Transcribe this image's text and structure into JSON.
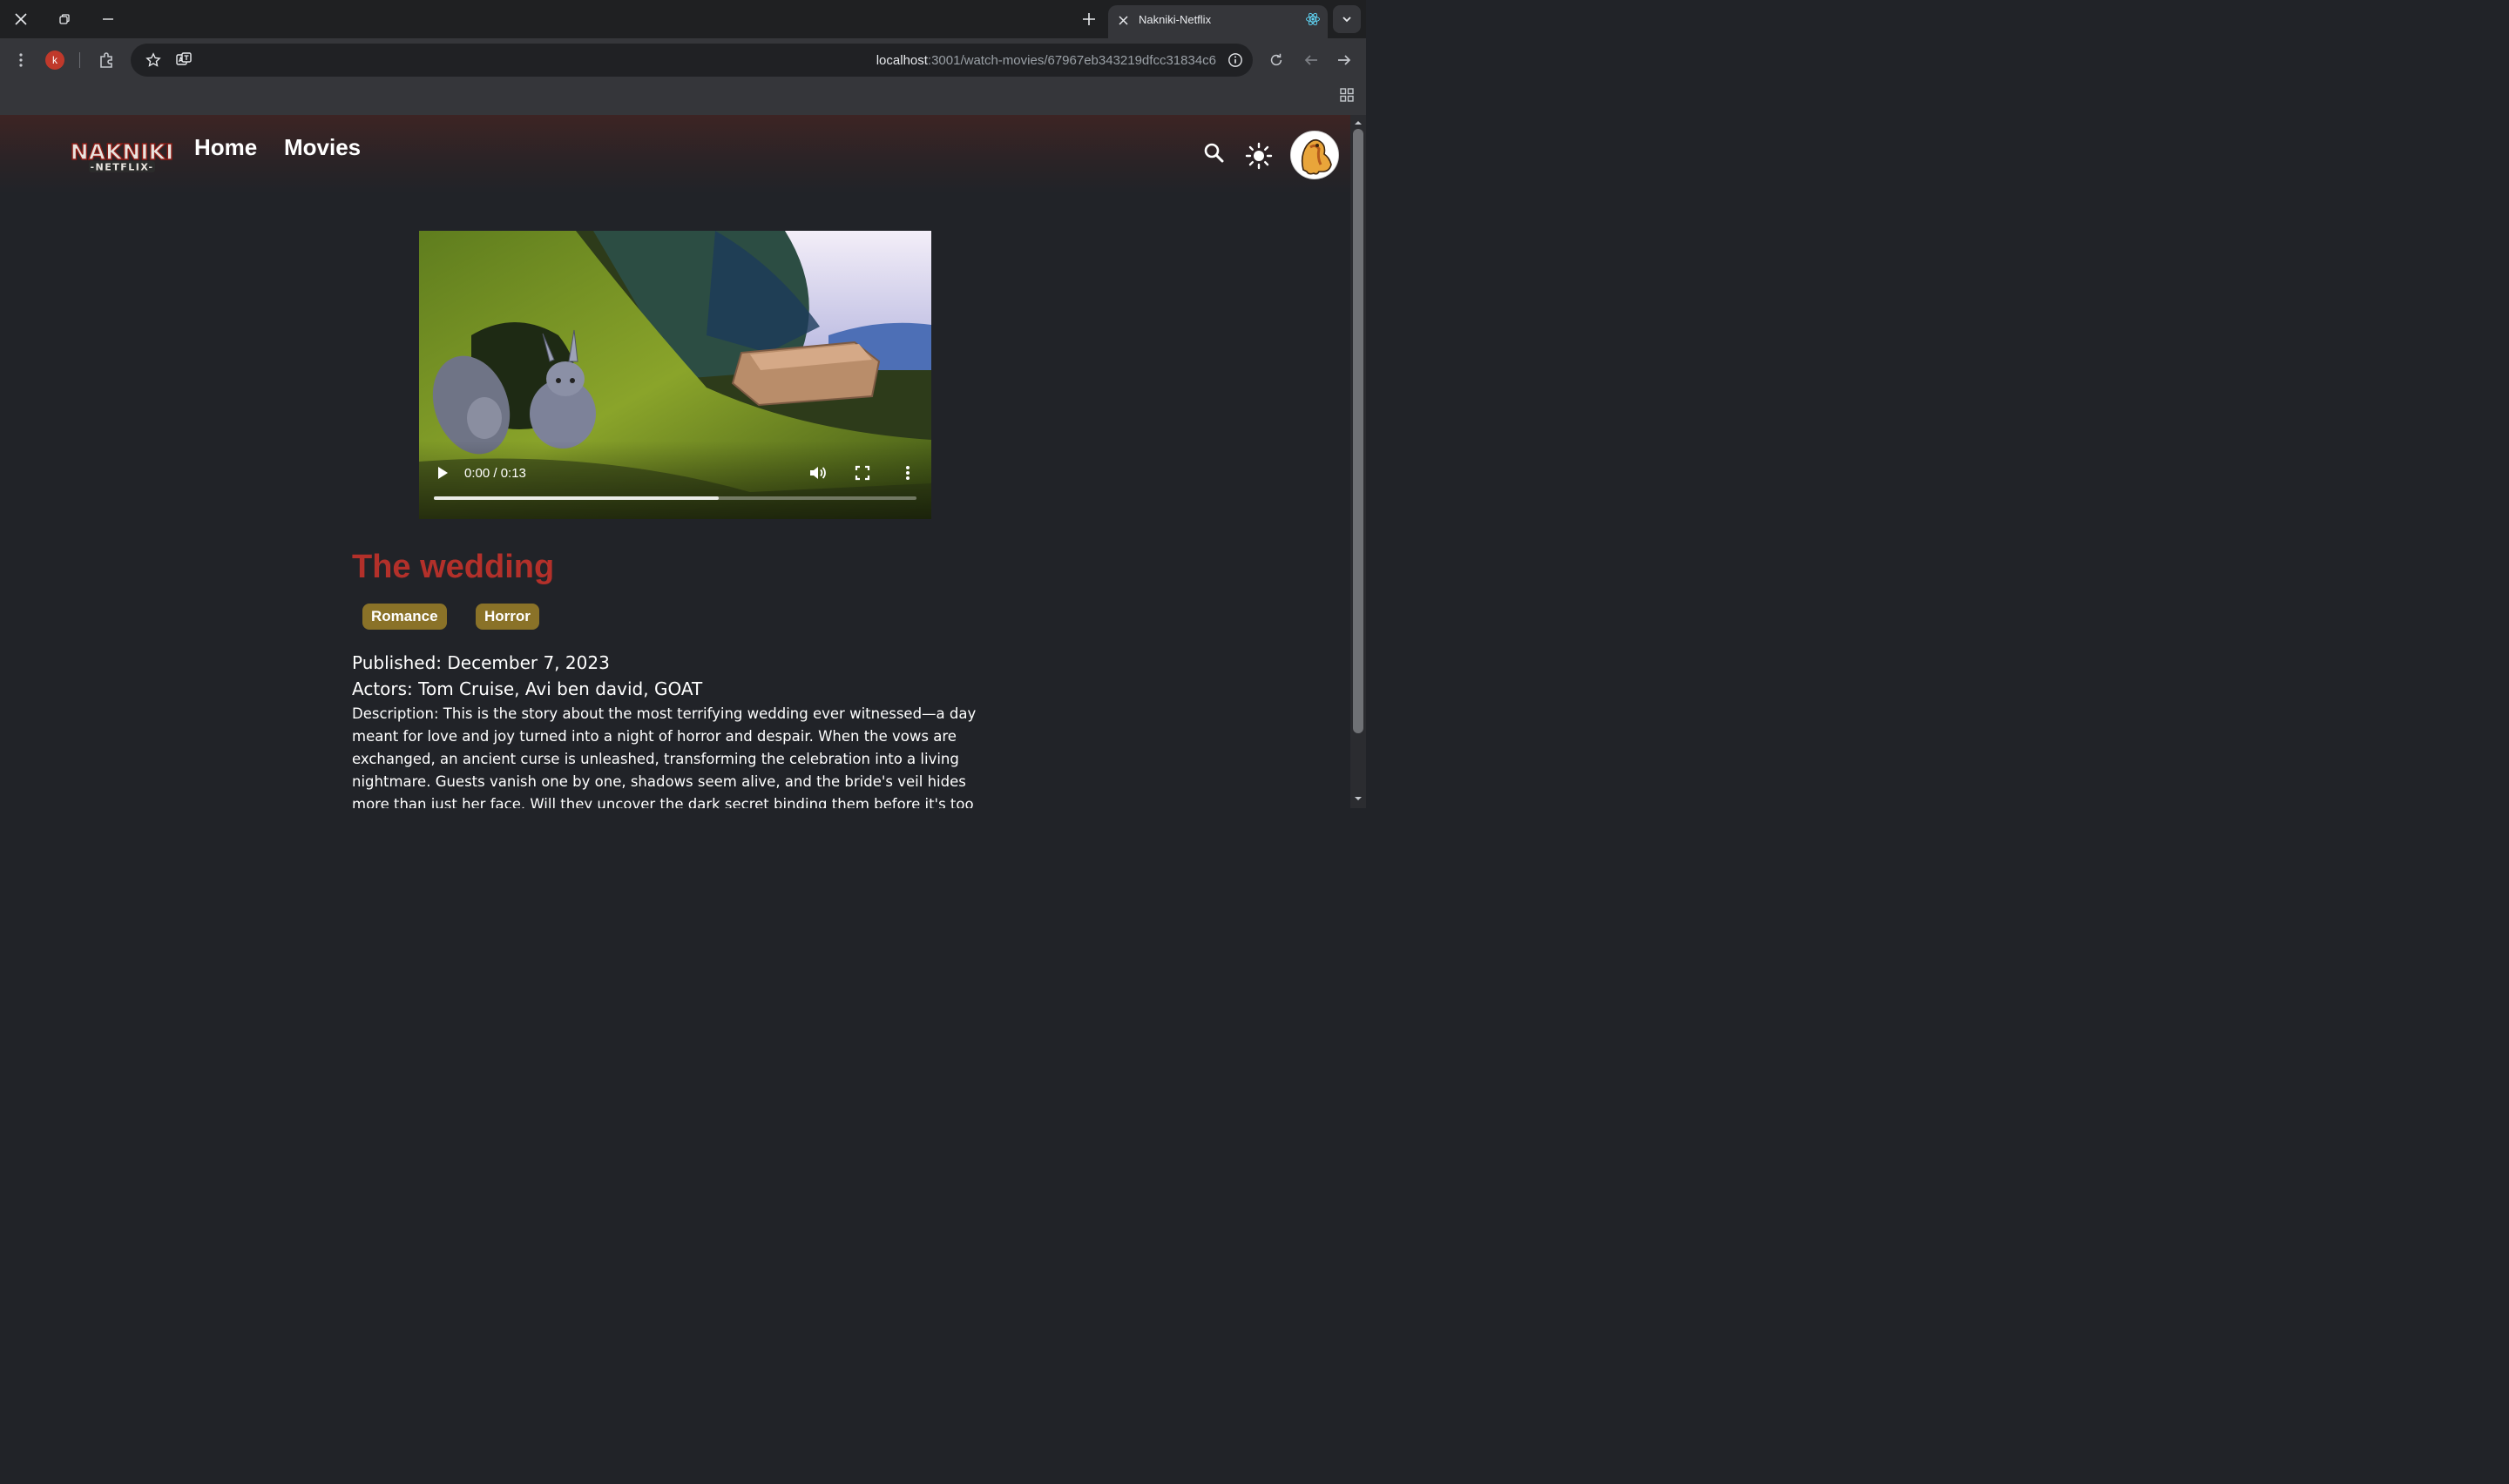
{
  "browser": {
    "tab": {
      "title": "Nakniki-Netflix"
    },
    "profile_initial": "k",
    "url_host": "localhost",
    "url_path": ":3001/watch-movies/67967eb343219dfcc31834c6"
  },
  "site": {
    "logo": {
      "main": "NAKNIKI",
      "sub": "-NETFLIX-"
    },
    "nav": [
      {
        "label": "Home"
      },
      {
        "label": "Movies"
      }
    ]
  },
  "player": {
    "time": "0:00 / 0:13",
    "buffered_fraction": 0.59
  },
  "movie": {
    "title": "The wedding",
    "genres": [
      "Romance",
      "Horror"
    ],
    "published": "Published: December 7, 2023",
    "actors": "Actors: Tom Cruise, Avi ben david, GOAT",
    "description": "Description: This is the story about the most terrifying wedding ever witnessed—a day meant for love and joy turned into a night of horror and despair. When the vows are exchanged, an ancient curse is unleashed, transforming the celebration into a living nightmare. Guests vanish one by one, shadows seem alive, and the bride's veil hides more than just her face. Will they uncover the dark secret binding them before it's too late? Or will this wedding become their"
  },
  "colors": {
    "title": "#b3302a",
    "badge": "#8a7228",
    "background": "#212328"
  }
}
